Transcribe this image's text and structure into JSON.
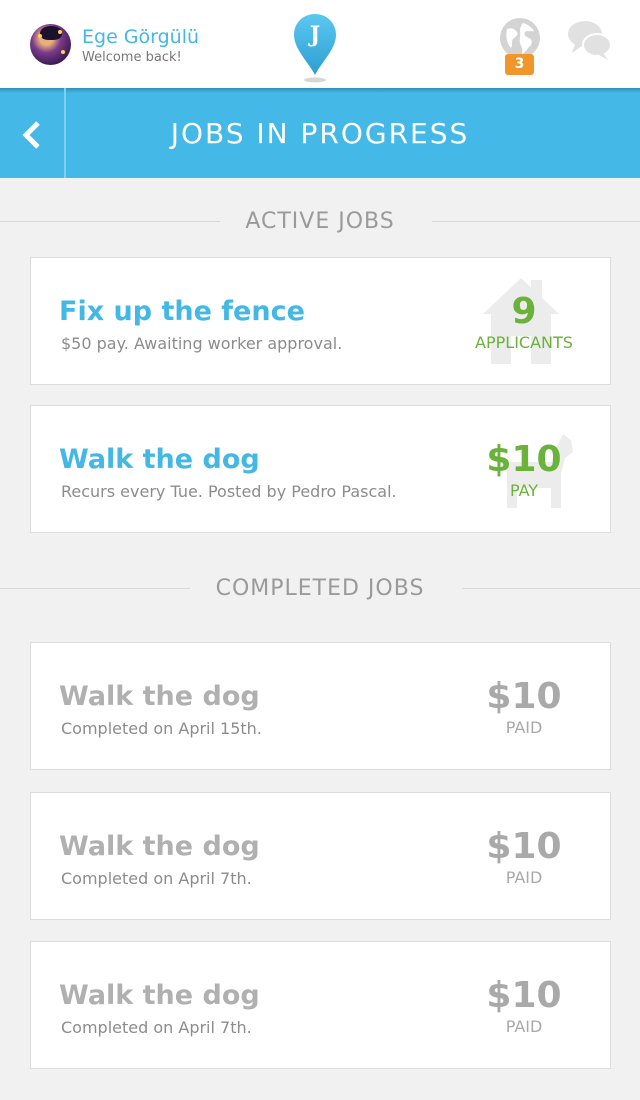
{
  "header": {
    "user_name": "Ege Görgülü",
    "welcome": "Welcome back!",
    "logo_letter": "J",
    "notification_count": "3",
    "icons": [
      "avatar",
      "jobs-logo-pin-icon",
      "globe-icon",
      "chat-bubbles-icon"
    ]
  },
  "titlebar": {
    "title": "JOBS IN PROGRESS",
    "back_icon": "chevron-left-icon"
  },
  "sections": {
    "active": "ACTIVE JOBS",
    "completed": "COMPLETED JOBS"
  },
  "active_jobs": [
    {
      "title": "Fix up the fence",
      "subtitle": "$50 pay. Awaiting worker approval.",
      "value": "9",
      "caption": "APPLICANTS",
      "icon": "house-icon"
    },
    {
      "title": "Walk the dog",
      "subtitle": "Recurs every Tue. Posted by Pedro Pascal.",
      "value": "$10",
      "caption": "PAY",
      "icon": "dog-icon"
    }
  ],
  "completed_jobs": [
    {
      "title": "Walk the dog",
      "subtitle": "Completed on April 15th.",
      "value": "$10",
      "caption": "PAID"
    },
    {
      "title": "Walk the dog",
      "subtitle": "Completed on April 7th.",
      "value": "$10",
      "caption": "PAID"
    },
    {
      "title": "Walk the dog",
      "subtitle": "Completed on April 7th.",
      "value": "$10",
      "caption": "PAID"
    }
  ],
  "colors": {
    "accent_blue": "#44b8e6",
    "green": "#6ab23a",
    "badge_orange": "#f0962a",
    "muted_grey": "#a9a9a9"
  }
}
